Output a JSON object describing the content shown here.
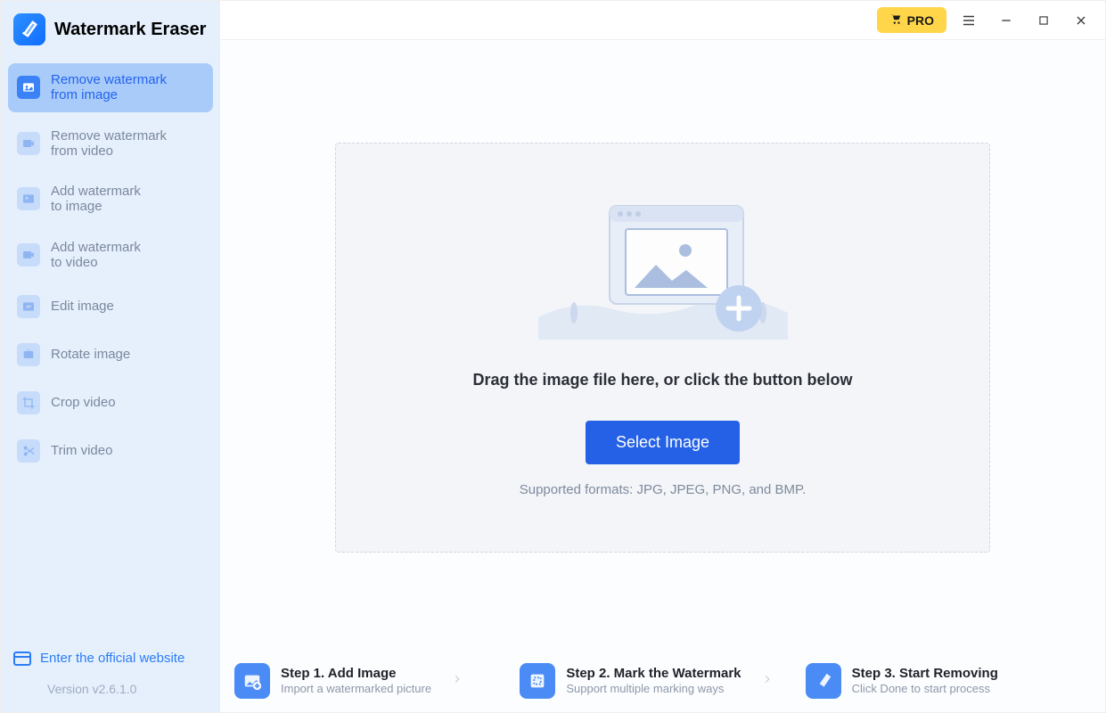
{
  "brand": {
    "title": "Watermark Eraser"
  },
  "titlebar": {
    "pro_label": "PRO"
  },
  "sidebar": {
    "items": [
      {
        "line1": "Remove watermark",
        "line2": "from image",
        "active": true
      },
      {
        "line1": "Remove watermark",
        "line2": "from video"
      },
      {
        "line1": "Add watermark",
        "line2": "to image"
      },
      {
        "line1": "Add watermark",
        "line2": "to video"
      },
      {
        "line1": "Edit image"
      },
      {
        "line1": "Rotate image"
      },
      {
        "line1": "Crop video"
      },
      {
        "line1": "Trim video"
      }
    ],
    "official_link": "Enter the official website",
    "version": "Version v2.6.1.0"
  },
  "dropzone": {
    "heading": "Drag the image file here, or click the button below",
    "button": "Select Image",
    "formats": "Supported formats: JPG, JPEG, PNG, and BMP."
  },
  "steps": [
    {
      "title": "Step 1. Add Image",
      "desc": "Import a watermarked picture"
    },
    {
      "title": "Step 2. Mark the Watermark",
      "desc": "Support multiple marking ways"
    },
    {
      "title": "Step 3. Start Removing",
      "desc": "Click Done to start process"
    }
  ]
}
